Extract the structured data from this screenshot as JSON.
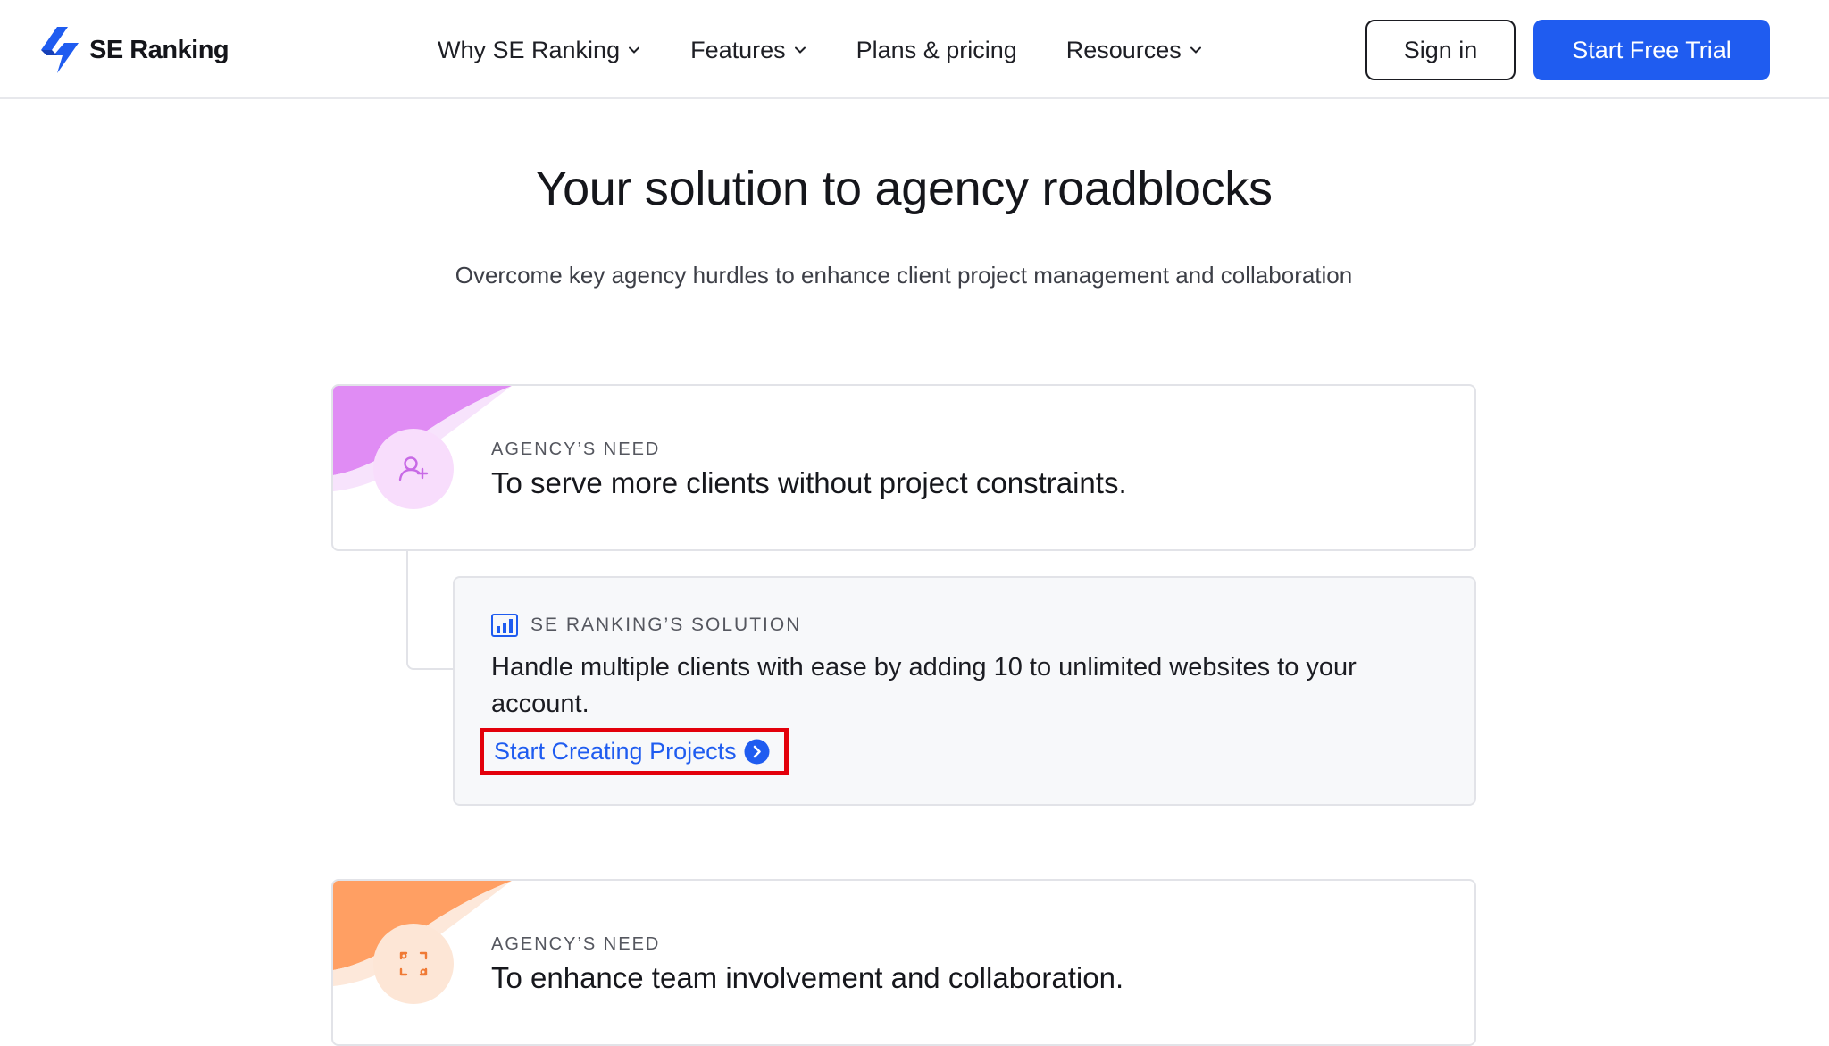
{
  "header": {
    "logo_text": "SE Ranking",
    "logo_icon": "lightning-bolt-icon",
    "nav": [
      {
        "label": "Why SE Ranking",
        "has_dropdown": true
      },
      {
        "label": "Features",
        "has_dropdown": true
      },
      {
        "label": "Plans & pricing",
        "has_dropdown": false
      },
      {
        "label": "Resources",
        "has_dropdown": true
      }
    ],
    "sign_in_label": "Sign in",
    "trial_label": "Start Free Trial"
  },
  "hero": {
    "title": "Your solution to agency roadblocks",
    "subtitle": "Overcome key agency hurdles to enhance client project management and collaboration"
  },
  "cards": [
    {
      "need_label": "AGENCY’S NEED",
      "need_text": "To serve more clients without project constraints.",
      "icon": "add-user-icon",
      "accent": "#e08cf4"
    },
    {
      "need_label": "AGENCY’S NEED",
      "need_text": "To enhance team involvement and collaboration.",
      "icon": "focus-frame-icon",
      "accent": "#ff9f63"
    }
  ],
  "solution": {
    "label": "SE RANKING’S SOLUTION",
    "icon": "bar-chart-icon",
    "text": "Handle multiple clients with ease by adding 10 to unlimited websites to your account.",
    "link_label": "Start Creating Projects"
  },
  "colors": {
    "brand_blue": "#1f5cf0",
    "highlight_red": "#e3000b"
  }
}
